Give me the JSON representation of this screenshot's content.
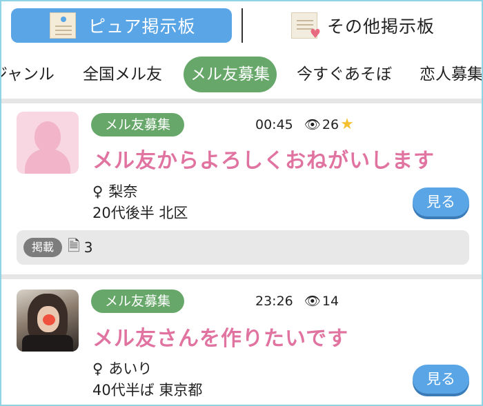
{
  "boards": {
    "active_label": "ピュア掲示板",
    "other_label": "その他掲示板"
  },
  "tabs": [
    {
      "label": "ジャンル"
    },
    {
      "label": "全国メル友"
    },
    {
      "label": "メル友募集",
      "active": true
    },
    {
      "label": "今すぐあそぼ"
    },
    {
      "label": "恋人募集"
    }
  ],
  "posts": [
    {
      "category": "メル友募集",
      "time": "00:45",
      "views": "26",
      "starred": true,
      "title": "メル友からよろしくおねがいします",
      "sex": "♀",
      "name": "梨奈",
      "profile": "20代後半 北区",
      "view_button": "見る",
      "post_label": "掲載",
      "post_count": "3"
    },
    {
      "category": "メル友募集",
      "time": "23:26",
      "views": "14",
      "starred": false,
      "title": "メル友さんを作りたいです",
      "sex": "♀",
      "name": "あいり",
      "profile": "40代半ば 東京都",
      "view_button": "見る"
    }
  ],
  "icons": {
    "views": "👁",
    "star": "★",
    "post_history": "🗎"
  },
  "colors": {
    "accent_blue": "#5aa5e6",
    "category_green": "#67a86a",
    "title_pink": "#e073a0",
    "star_yellow": "#f5c02e"
  }
}
